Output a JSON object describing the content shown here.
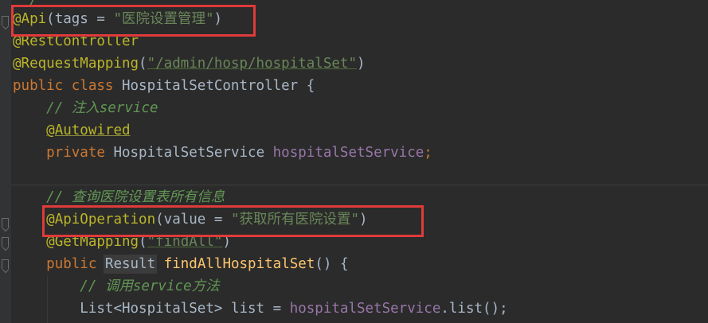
{
  "editor": {
    "lines": [
      {
        "id": "l0",
        "tokens": [
          {
            "t": "  /",
            "c": "cmt"
          }
        ]
      },
      {
        "id": "l1",
        "tokens": [
          {
            "t": "@Api",
            "c": "ann"
          },
          {
            "t": "(tags = ",
            "c": "plain"
          },
          {
            "t": "\"医院设置管理\"",
            "c": "str"
          },
          {
            "t": ")",
            "c": "plain"
          }
        ]
      },
      {
        "id": "l2",
        "tokens": [
          {
            "t": "@RestController",
            "c": "ann"
          }
        ]
      },
      {
        "id": "l3",
        "tokens": [
          {
            "t": "@RequestMapping",
            "c": "ann"
          },
          {
            "t": "(",
            "c": "plain"
          },
          {
            "t": "\"/admin/hosp/hospitalSet\"",
            "c": "str"
          },
          {
            "t": ")",
            "c": "plain"
          }
        ]
      },
      {
        "id": "l4",
        "tokens": [
          {
            "t": "public class ",
            "c": "kw"
          },
          {
            "t": "HospitalSetController ",
            "c": "plain"
          },
          {
            "t": "{",
            "c": "plain"
          }
        ]
      },
      {
        "id": "l5",
        "tokens": [
          {
            "t": "    ",
            "c": "plain"
          },
          {
            "t": "// 注入service",
            "c": "cmt"
          }
        ]
      },
      {
        "id": "l6",
        "tokens": [
          {
            "t": "    ",
            "c": "plain"
          },
          {
            "t": "@Autowired",
            "c": "ann"
          }
        ]
      },
      {
        "id": "l7",
        "tokens": [
          {
            "t": "    ",
            "c": "plain"
          },
          {
            "t": "private ",
            "c": "kw"
          },
          {
            "t": "HospitalSetService ",
            "c": "plain"
          },
          {
            "t": "hospitalSetService",
            "c": "field"
          },
          {
            "t": ";",
            "c": "kw"
          }
        ]
      },
      {
        "id": "l8",
        "tokens": []
      },
      {
        "id": "l9",
        "tokens": [
          {
            "t": "    ",
            "c": "plain"
          },
          {
            "t": "// 查询医院设置表所有信息",
            "c": "cmt"
          }
        ]
      },
      {
        "id": "l10",
        "tokens": [
          {
            "t": "    ",
            "c": "plain"
          },
          {
            "t": "@ApiOperation",
            "c": "ann"
          },
          {
            "t": "(value = ",
            "c": "plain"
          },
          {
            "t": "\"获取所有医院设置\"",
            "c": "str"
          },
          {
            "t": ")",
            "c": "plain"
          }
        ]
      },
      {
        "id": "l11",
        "tokens": [
          {
            "t": "    ",
            "c": "plain"
          },
          {
            "t": "@GetMapping",
            "c": "ann"
          },
          {
            "t": "(",
            "c": "plain"
          },
          {
            "t": "\"findAll\"",
            "c": "str"
          },
          {
            "t": ")",
            "c": "plain"
          }
        ]
      },
      {
        "id": "l12",
        "tokens": [
          {
            "t": "    ",
            "c": "plain"
          },
          {
            "t": "public ",
            "c": "kw"
          },
          {
            "t": "Result",
            "c": "plain"
          },
          {
            "t": " ",
            "c": "plain"
          },
          {
            "t": "findAllHospitalSet",
            "c": "fn"
          },
          {
            "t": "() {",
            "c": "plain"
          }
        ]
      },
      {
        "id": "l13",
        "tokens": [
          {
            "t": "        ",
            "c": "plain"
          },
          {
            "t": "// 调用service方法",
            "c": "cmt"
          }
        ]
      },
      {
        "id": "l14",
        "tokens": [
          {
            "t": "        ",
            "c": "plain"
          },
          {
            "t": "List<HospitalSet> list = ",
            "c": "plain"
          },
          {
            "t": "hospitalSetService",
            "c": "field"
          },
          {
            "t": ".list();",
            "c": "plain"
          }
        ]
      }
    ]
  },
  "colors": {
    "background": "#2b2b2b",
    "annotation": "#bbb529",
    "string": "#6a8759",
    "keyword": "#cc7832",
    "comment": "#629755",
    "field": "#9876aa",
    "default": "#a9b7c6",
    "highlight_frame": "#e03a3a"
  }
}
